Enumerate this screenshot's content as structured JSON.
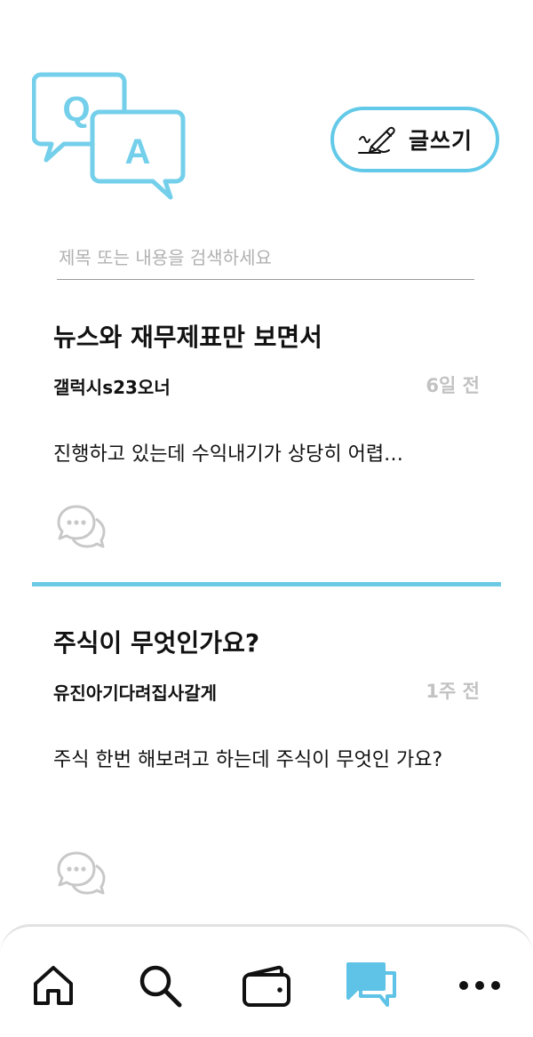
{
  "header": {
    "logo": {
      "icon": "qa-bubbles-icon",
      "q": "Q",
      "a": "A"
    },
    "write_button": {
      "label": "글쓰기",
      "icon": "pen-writing-icon"
    }
  },
  "search": {
    "placeholder": "제목 또는 내용을 검색하세요",
    "value": ""
  },
  "posts": [
    {
      "title": "뉴스와 재무제표만 보면서",
      "author": "갤럭시s23오너",
      "time": "6일 전",
      "body": "진행하고 있는데 수익내기가 상당히 어렵…",
      "comment_icon": "comment-bubbles-icon"
    },
    {
      "title": "주식이 무엇인가요?",
      "author": "유진아기다려집사갈게",
      "time": "1주 전",
      "body": "주식 한번 해보려고 하는데 주식이 무엇인 가요?",
      "comment_icon": "comment-bubbles-icon"
    }
  ],
  "tabbar": {
    "items": [
      {
        "name": "home",
        "icon": "home-icon",
        "active": false
      },
      {
        "name": "search",
        "icon": "search-icon",
        "active": false
      },
      {
        "name": "wallet",
        "icon": "wallet-icon",
        "active": false
      },
      {
        "name": "community",
        "icon": "chat-icon",
        "active": true
      },
      {
        "name": "more",
        "icon": "more-dots-icon",
        "active": false
      }
    ]
  },
  "colors": {
    "accent": "#6ccae4",
    "text": "#111111",
    "muted": "#c2c2c2",
    "placeholder": "#b1b1b1"
  }
}
